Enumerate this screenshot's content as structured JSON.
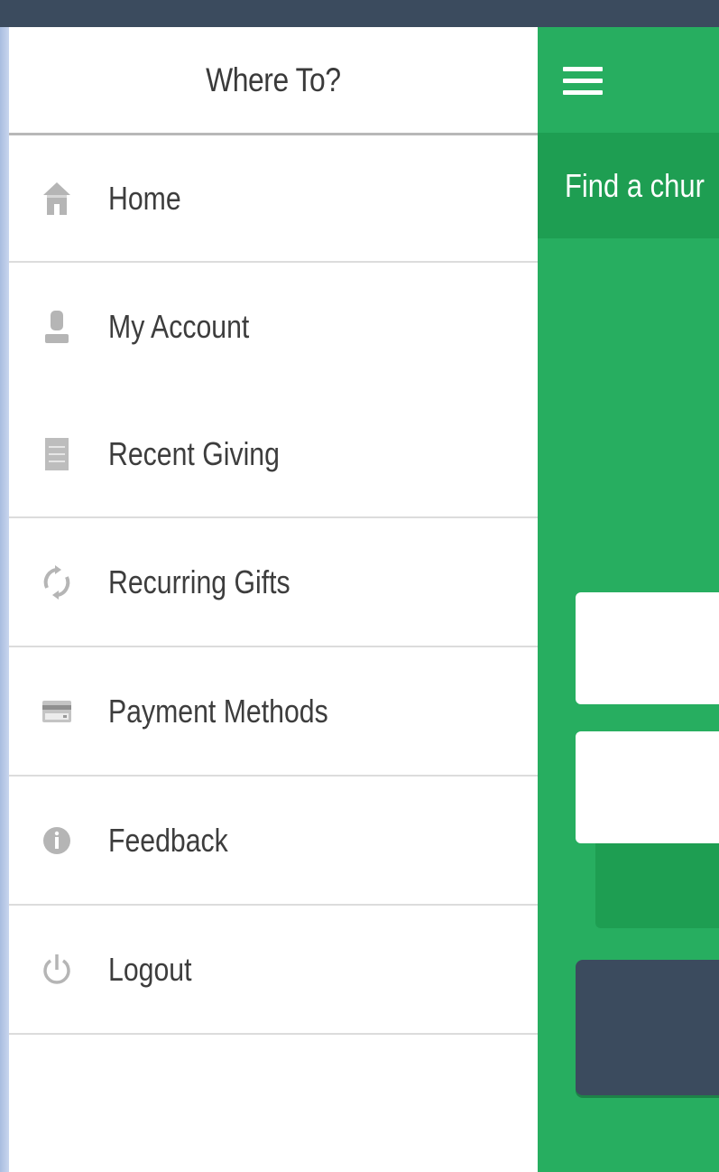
{
  "drawer": {
    "title": "Where To?",
    "items": [
      {
        "label": "Home",
        "icon": "home-icon"
      },
      {
        "label": "My Account",
        "icon": "user-icon"
      },
      {
        "label": "Recent Giving",
        "icon": "list-icon"
      },
      {
        "label": "Recurring Gifts",
        "icon": "refresh-icon"
      },
      {
        "label": "Payment Methods",
        "icon": "credit-card-icon"
      },
      {
        "label": "Feedback",
        "icon": "info-icon"
      },
      {
        "label": "Logout",
        "icon": "power-icon"
      }
    ]
  },
  "main": {
    "menu_icon": "hamburger-icon",
    "subheader_text": "Find a chur",
    "colors": {
      "primary_green": "#27ae60",
      "dark_green": "#1e9e52",
      "dark_slate": "#3b4b5e",
      "icon_gray": "#b5b5b5"
    }
  }
}
